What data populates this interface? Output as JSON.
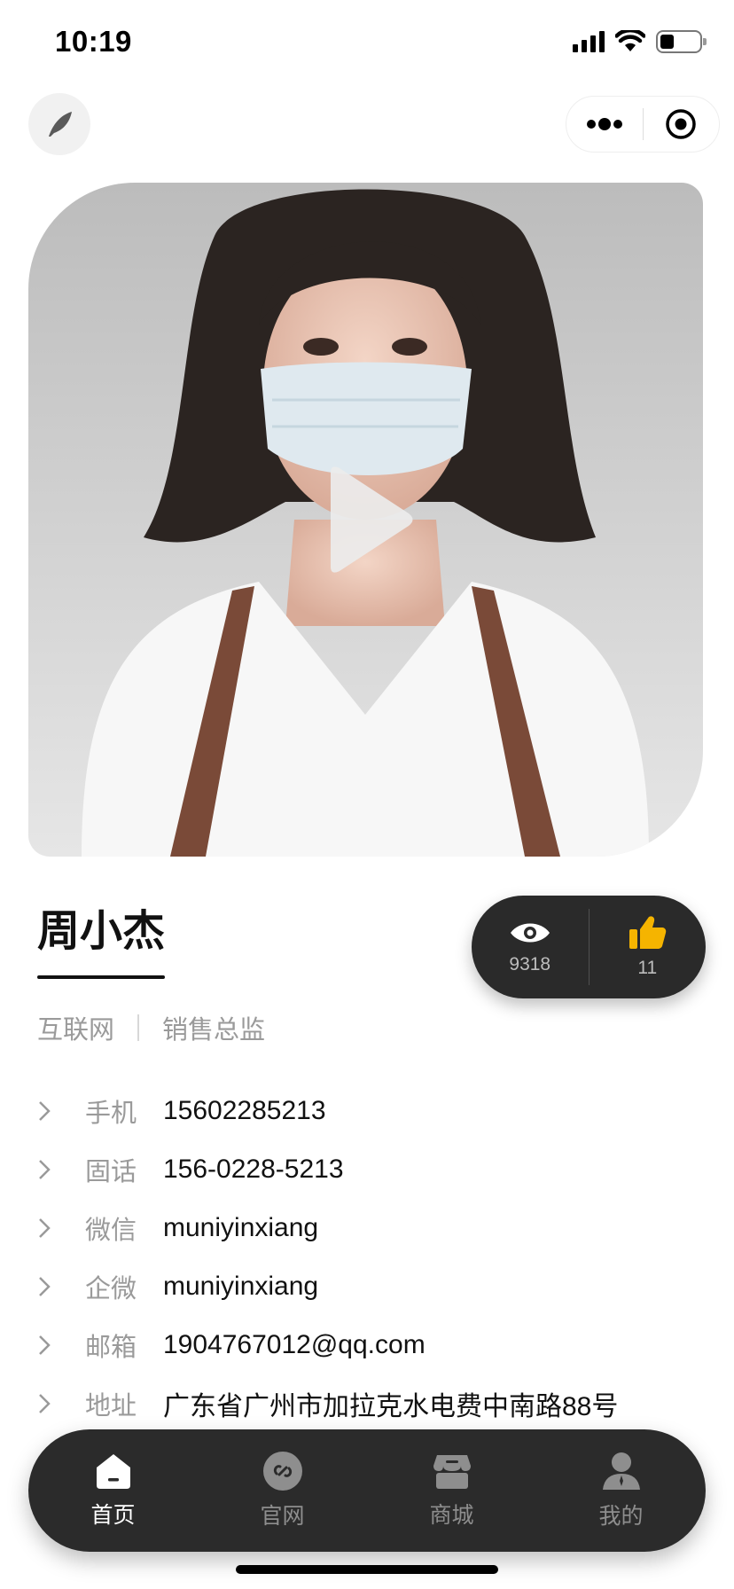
{
  "status_bar": {
    "time": "10:19",
    "battery_level": 0.35
  },
  "nav": {
    "logo_icon": "feather-icon",
    "more_icon": "more-dots-icon",
    "close_icon": "target-icon"
  },
  "hero": {
    "type": "video-cover",
    "play_icon": "play-icon"
  },
  "profile": {
    "name": "周小杰",
    "industry": "互联网",
    "title": "销售总监"
  },
  "stats": {
    "views": "9318",
    "likes": "11",
    "like_color": "#f5b400"
  },
  "contacts": [
    {
      "label": "手机",
      "value": "15602285213"
    },
    {
      "label": "固话",
      "value": "156-0228-5213"
    },
    {
      "label": "微信",
      "value": "muniyinxiang"
    },
    {
      "label": "企微",
      "value": "muniyinxiang"
    },
    {
      "label": "邮箱",
      "value": "1904767012@qq.com"
    },
    {
      "label": "地址",
      "value": "广东省广州市加拉克水电费中南路88号"
    }
  ],
  "tabbar": {
    "tabs": [
      {
        "label": "首页",
        "icon": "home-icon",
        "active": true
      },
      {
        "label": "官网",
        "icon": "link-icon",
        "active": false
      },
      {
        "label": "商城",
        "icon": "shop-icon",
        "active": false
      },
      {
        "label": "我的",
        "icon": "user-icon",
        "active": false
      }
    ],
    "active_color": "#ffffff",
    "inactive_color": "#8e8e8e"
  }
}
